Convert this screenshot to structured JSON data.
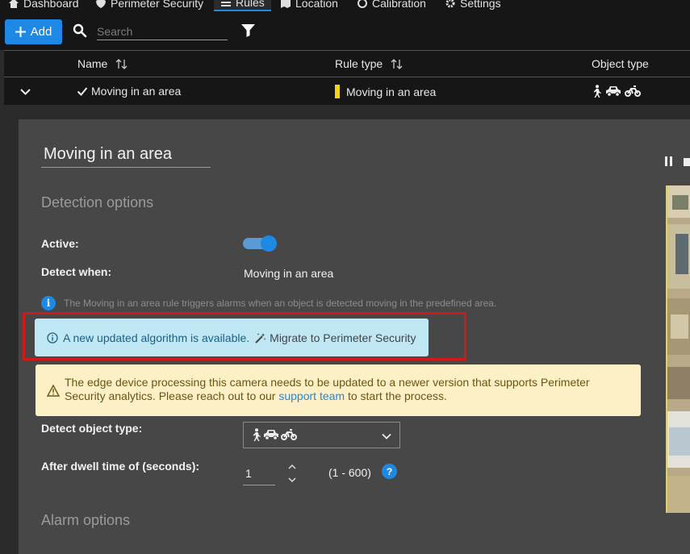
{
  "nav": {
    "items": [
      {
        "label": "Dashboard",
        "icon": "home-icon"
      },
      {
        "label": "Perimeter Security",
        "icon": "shield-icon"
      },
      {
        "label": "Rules",
        "icon": "list-icon",
        "active": true
      },
      {
        "label": "Location",
        "icon": "map-icon"
      },
      {
        "label": "Calibration",
        "icon": "calibration-icon"
      },
      {
        "label": "Settings",
        "icon": "gear-icon"
      }
    ]
  },
  "toolbar": {
    "add_label": "Add",
    "search_placeholder": "Search"
  },
  "table": {
    "columns": [
      "Name",
      "Rule type",
      "Object type"
    ],
    "row": {
      "name": "Moving in an area",
      "rule_type": "Moving in an area",
      "rule_color": "#f2d21b",
      "object_icons": [
        "person-icon",
        "car-icon",
        "bike-icon"
      ]
    }
  },
  "detail": {
    "rule_name": "Moving in an area",
    "detection_title": "Detection options",
    "active_label": "Active:",
    "active": true,
    "detect_when_label": "Detect when:",
    "detect_when_value": "Moving in an area",
    "info_text": "The Moving in an area rule triggers alarms when an object is detected moving in the predefined area.",
    "algo_text": "A new updated algorithm is available.",
    "migrate_label": "Migrate to Perimeter Security",
    "warn_text_before": "The edge device processing this camera needs to be updated to a newer version that supports Perimeter Security analytics. Please reach out to our ",
    "warn_link": "support team",
    "warn_text_after": " to start the process.",
    "object_type_label": "Detect object type:",
    "dwell_label": "After dwell time of (seconds):",
    "dwell_value": "1",
    "dwell_range": "(1 - 600)",
    "alarm_title": "Alarm options"
  },
  "colors": {
    "accent": "#1e88e5",
    "highlight_border": "#d21919",
    "info_bg": "#bfe7f4",
    "warning_bg": "#fef0c6"
  }
}
